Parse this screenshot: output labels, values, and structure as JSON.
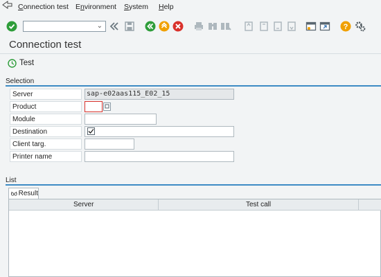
{
  "menu": {
    "items": [
      {
        "label": "Connection test",
        "underline": "C",
        "rest": "onnection test"
      },
      {
        "label": "Environment",
        "pre": "E",
        "underline": "n",
        "rest": "vironment"
      },
      {
        "label": "System",
        "underline": "S",
        "rest": "ystem"
      },
      {
        "label": "Help",
        "underline": "H",
        "rest": "elp"
      }
    ]
  },
  "toolbar": {
    "command_field_value": "",
    "icons": [
      "check-icon",
      "back-double-icon",
      "save-icon",
      "back-green-icon",
      "exit-yellow-icon",
      "cancel-red-icon",
      "print-icon",
      "find-icon",
      "find-next-icon",
      "first-page-icon",
      "prev-page-icon",
      "next-page-icon",
      "last-page-icon",
      "new-session-icon",
      "shortcut-icon",
      "help-icon",
      "settings-icon"
    ]
  },
  "title": "Connection test",
  "test_button": {
    "label": "Test"
  },
  "selection": {
    "header": "Selection",
    "fields": {
      "server": {
        "label": "Server",
        "value": "sap-e02aas115_E02_15"
      },
      "product": {
        "label": "Product",
        "value": ""
      },
      "module": {
        "label": "Module",
        "value": ""
      },
      "destination": {
        "label": "Destination",
        "checked": true
      },
      "client": {
        "label": "Client targ.",
        "value": ""
      },
      "printer": {
        "label": "Printer name",
        "value": ""
      }
    }
  },
  "list": {
    "header": "List",
    "tab_label": "Result",
    "columns": [
      "Server",
      "Test call"
    ]
  },
  "colors": {
    "accent": "#3d8bc4",
    "green": "#2e9d3a",
    "orange": "#f0a000",
    "red": "#d9312b"
  }
}
